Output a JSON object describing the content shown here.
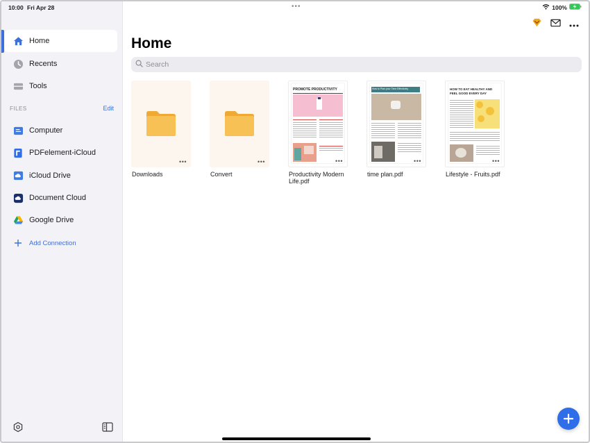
{
  "status": {
    "time": "10:00",
    "date": "Fri Apr 28",
    "battery": "100%",
    "multitask": "•••"
  },
  "sidebar": {
    "items": [
      {
        "label": "Home",
        "icon": "home-icon"
      },
      {
        "label": "Recents",
        "icon": "clock-icon"
      },
      {
        "label": "Tools",
        "icon": "tools-icon"
      }
    ],
    "files_section": {
      "label": "FILES",
      "edit": "Edit"
    },
    "locations": [
      {
        "label": "Computer",
        "icon": "computer-icon"
      },
      {
        "label": "PDFelement-iCloud",
        "icon": "pdfelement-icon"
      },
      {
        "label": "iCloud Drive",
        "icon": "icloud-drive-icon"
      },
      {
        "label": "Document Cloud",
        "icon": "document-cloud-icon"
      },
      {
        "label": "Google Drive",
        "icon": "google-drive-icon"
      }
    ],
    "add_connection": "Add Connection"
  },
  "main": {
    "title": "Home",
    "search_placeholder": "Search",
    "files": [
      {
        "name": "Downloads",
        "type": "folder"
      },
      {
        "name": "Convert",
        "type": "folder"
      },
      {
        "name": "Productivity Modern Life.pdf",
        "type": "pdf",
        "thumb_title": "PROMOTE PRODUCTIVITY"
      },
      {
        "name": "time plan.pdf",
        "type": "pdf",
        "thumb_title": "How to Plan your Time Effectively"
      },
      {
        "name": "Lifestyle - Fruits.pdf",
        "type": "pdf",
        "thumb_title": "HOW TO EAT HEALTHY AND FEEL GOOD EVERY DAY"
      }
    ],
    "more": "•••"
  },
  "colors": {
    "accent": "#3f6fd8",
    "fab": "#2f6ee8",
    "folder": "#f7c155",
    "premium": "#f2a51a"
  }
}
